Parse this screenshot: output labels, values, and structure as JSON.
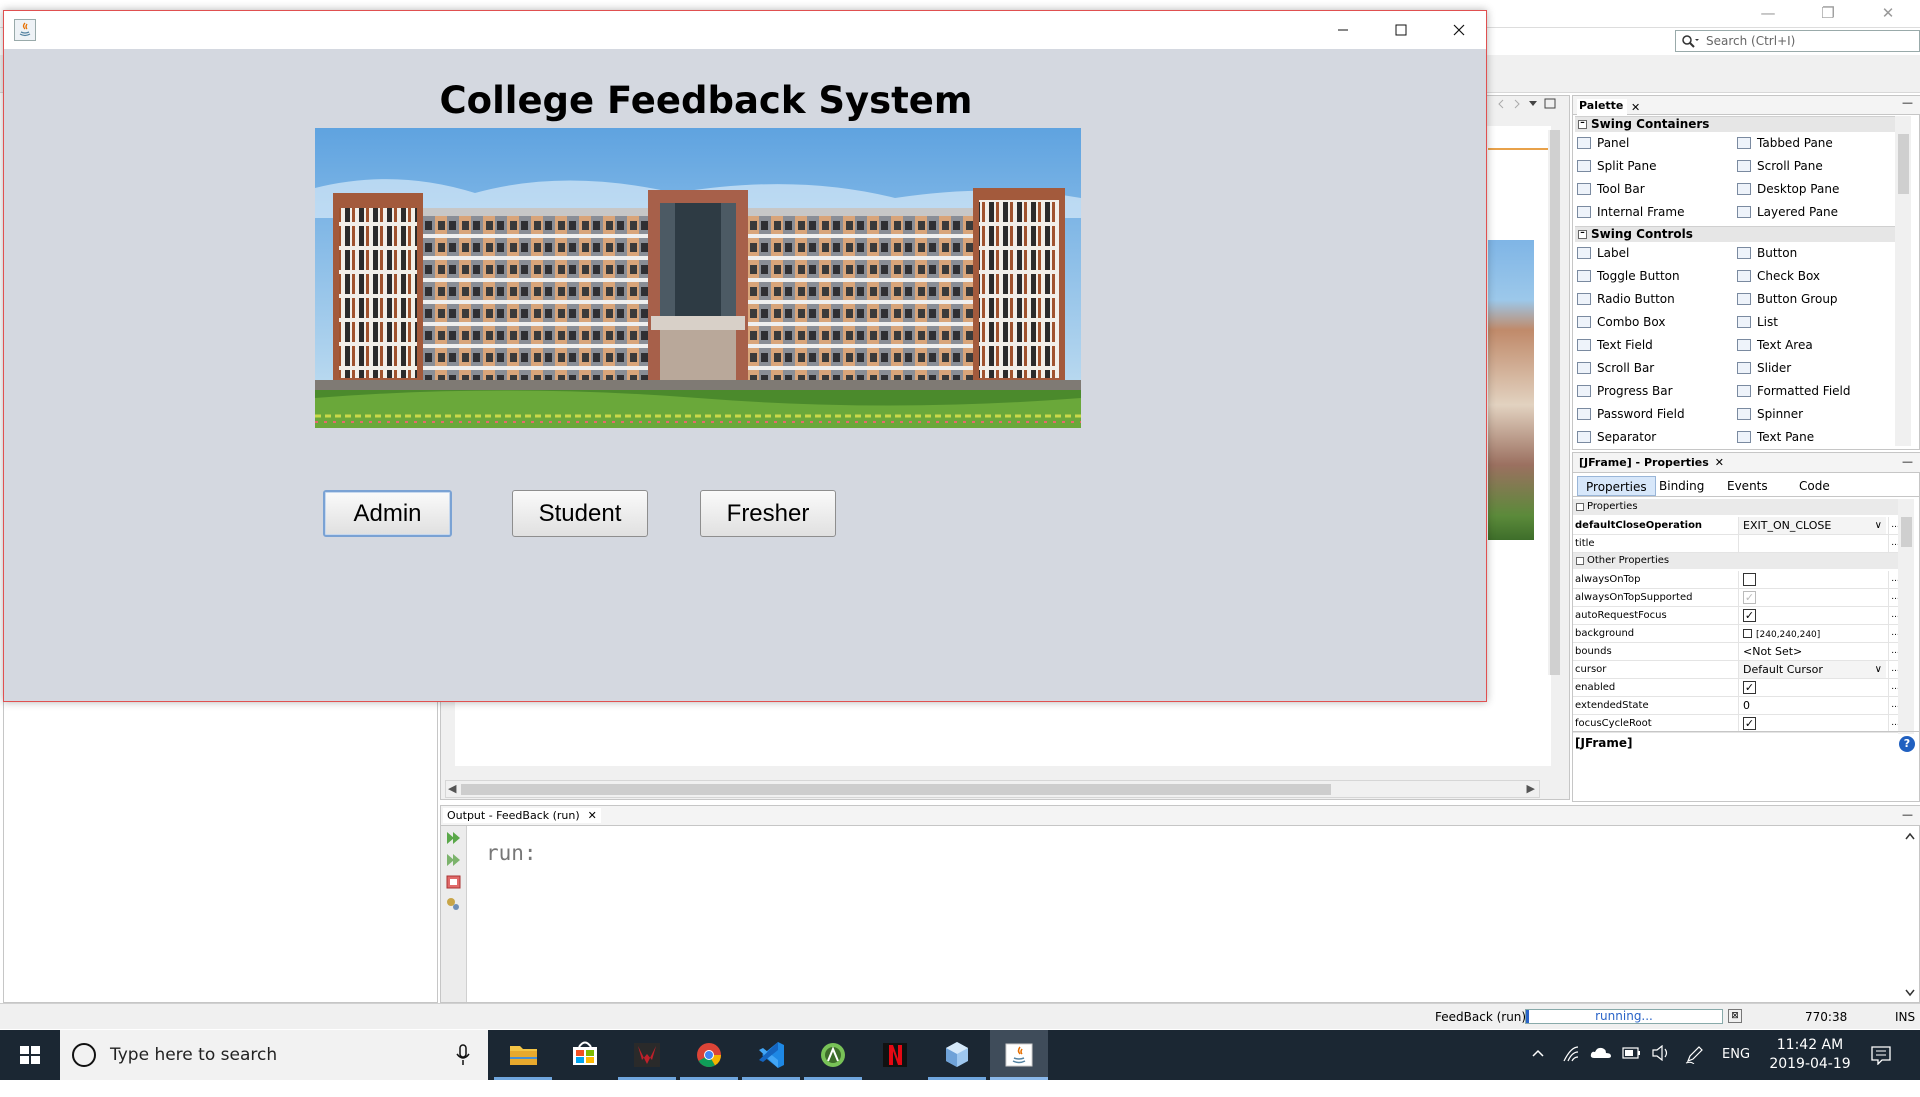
{
  "ide": {
    "search_placeholder": "Search (Ctrl+I)",
    "palette": {
      "tab_label": "Palette",
      "categories": [
        {
          "name": "Swing Containers",
          "items": [
            "Panel",
            "Tabbed Pane",
            "Split Pane",
            "Scroll Pane",
            "Tool Bar",
            "Desktop Pane",
            "Internal Frame",
            "Layered Pane"
          ]
        },
        {
          "name": "Swing Controls",
          "items": [
            "Label",
            "Button",
            "Toggle Button",
            "Check Box",
            "Radio Button",
            "Button Group",
            "Combo Box",
            "List",
            "Text Field",
            "Text Area",
            "Scroll Bar",
            "Slider",
            "Progress Bar",
            "Formatted Field",
            "Password Field",
            "Spinner",
            "Separator",
            "Text Pane"
          ]
        }
      ]
    },
    "properties": {
      "title": "[JFrame] - Properties",
      "tabs": [
        "Properties",
        "Binding",
        "Events",
        "Code"
      ],
      "section_properties": "Properties",
      "section_other": "Other Properties",
      "rows": [
        {
          "key": "defaultCloseOperation",
          "value": "EXIT_ON_CLOSE",
          "kind": "select"
        },
        {
          "key": "title",
          "value": "",
          "kind": "text"
        },
        {
          "key": "alwaysOnTop",
          "value": "",
          "kind": "checkbox",
          "checked": false
        },
        {
          "key": "alwaysOnTopSupported",
          "value": "",
          "kind": "checkbox-disabled",
          "checked": true
        },
        {
          "key": "autoRequestFocus",
          "value": "",
          "kind": "checkbox",
          "checked": true
        },
        {
          "key": "background",
          "value": "[240,240,240]",
          "kind": "color"
        },
        {
          "key": "bounds",
          "value": "<Not Set>",
          "kind": "text"
        },
        {
          "key": "cursor",
          "value": "Default Cursor",
          "kind": "select"
        },
        {
          "key": "enabled",
          "value": "",
          "kind": "checkbox",
          "checked": true
        },
        {
          "key": "extendedState",
          "value": "0",
          "kind": "text"
        },
        {
          "key": "focusCycleRoot",
          "value": "",
          "kind": "checkbox",
          "checked": true
        }
      ],
      "help_label": "[JFrame]"
    },
    "output": {
      "tab_label": "Output - FeedBack (run)",
      "text": "run:"
    },
    "status": {
      "process": "FeedBack (run)",
      "progress_text": "running...",
      "caret": "770:38",
      "mode": "INS"
    }
  },
  "app": {
    "heading": "College Feedback System",
    "buttons": [
      "Admin",
      "Student",
      "Fresher"
    ],
    "focused_button": "Admin"
  },
  "taskbar": {
    "search_placeholder": "Type here to search",
    "apps": [
      "file-explorer",
      "microsoft-store",
      "game-app",
      "chrome",
      "vscode",
      "android-studio",
      "netflix",
      "virtualbox",
      "java"
    ],
    "active_app": "java",
    "language": "ENG",
    "time": "11:42 AM",
    "date": "2019-04-19"
  },
  "colors": {
    "app_background": "#d4d8e0",
    "window_border": "#e05050",
    "taskbar": "#1b2733",
    "progress": "#2a64c8"
  }
}
